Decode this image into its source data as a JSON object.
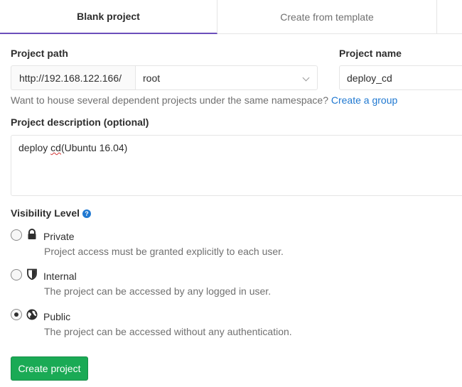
{
  "tabs": [
    {
      "label": "Blank project",
      "active": true
    },
    {
      "label": "Create from template",
      "active": false
    }
  ],
  "project_path": {
    "label": "Project path",
    "prefix": "http://192.168.122.166/",
    "namespace": "root"
  },
  "project_name": {
    "label": "Project name",
    "value": "deploy_cd"
  },
  "help": {
    "text": "Want to house several dependent projects under the same namespace?",
    "link": "Create a group"
  },
  "description": {
    "label": "Project description (optional)",
    "value_pre": "deploy ",
    "value_misspelled": "cd",
    "value_post": "(Ubuntu 16.04)"
  },
  "visibility": {
    "label": "Visibility Level",
    "help_icon": "question-circle-icon",
    "selected": "public",
    "options": [
      {
        "id": "private",
        "icon": "lock-icon",
        "title": "Private",
        "desc": "Project access must be granted explicitly to each user."
      },
      {
        "id": "internal",
        "icon": "shield-icon",
        "title": "Internal",
        "desc": "The project can be accessed by any logged in user."
      },
      {
        "id": "public",
        "icon": "globe-icon",
        "title": "Public",
        "desc": "The project can be accessed without any authentication."
      }
    ]
  },
  "submit": {
    "label": "Create project"
  },
  "colors": {
    "accent": "#6b4fbb",
    "link": "#1f78d1",
    "success": "#1aaa55"
  }
}
